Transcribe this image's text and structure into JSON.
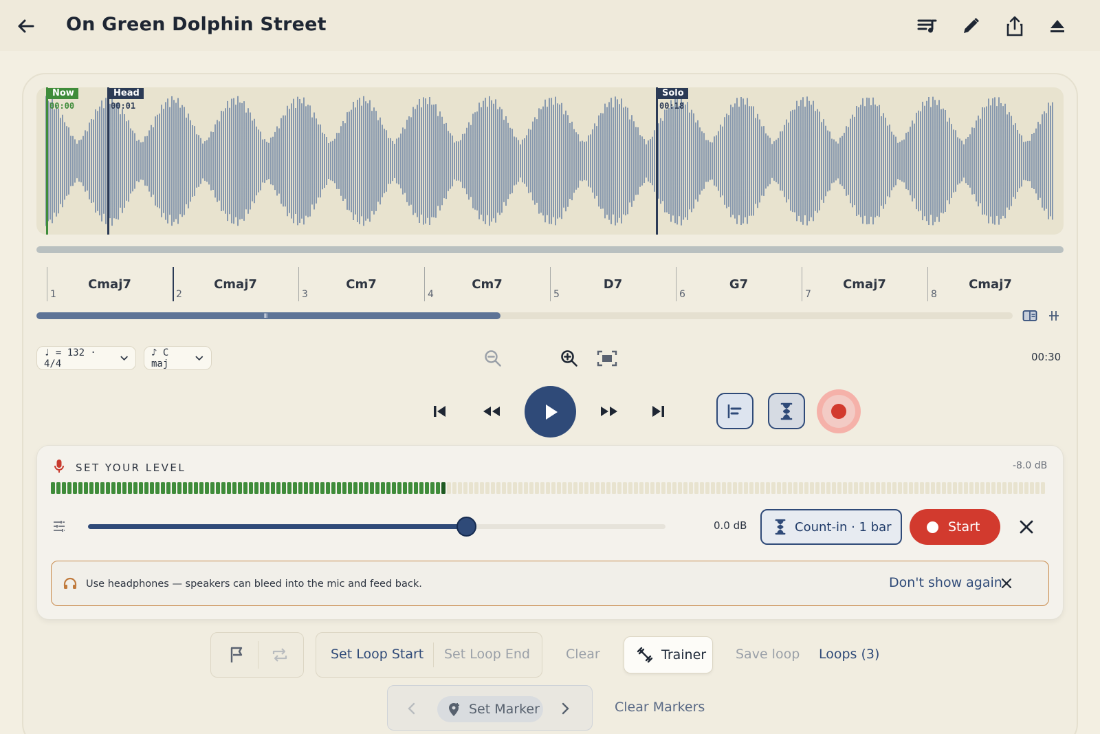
{
  "app": {
    "title": "On Green Dolphin Street",
    "icons": [
      "back-arrow-icon",
      "playlist-icon",
      "edit-pencil-icon",
      "share-icon",
      "eject-icon"
    ]
  },
  "waveform": {
    "markers": [
      {
        "label": "Now",
        "time": "00:00",
        "color": "#3f8c3a"
      },
      {
        "label": "Head",
        "time": "00:01",
        "color": "#2b3a55"
      },
      {
        "label": "Solo",
        "time": "00:18",
        "color": "#2b3a55"
      }
    ],
    "color": "#6f86a6"
  },
  "bars": [
    {
      "num": "1",
      "chord": "Cmaj7"
    },
    {
      "num": "2",
      "chord": "Cmaj7"
    },
    {
      "num": "3",
      "chord": "Cm7"
    },
    {
      "num": "4",
      "chord": "Cm7"
    },
    {
      "num": "5",
      "chord": "D7"
    },
    {
      "num": "6",
      "chord": "G7"
    },
    {
      "num": "7",
      "chord": "Cmaj7"
    },
    {
      "num": "8",
      "chord": "Cmaj7"
    }
  ],
  "scrub": {
    "progress": 0.475,
    "grip": "III"
  },
  "controls": {
    "tempo_chip": "♩ = 132 · 4/4",
    "key_chip": "♪ C maj",
    "duration": "00:30"
  },
  "level": {
    "title": "SET YOUR LEVEL",
    "db_reading": "-8.0 dB",
    "meter_fraction": 0.395,
    "gain_value": "0.0 dB",
    "gain_fraction": 0.655,
    "countin_label": "Count-in · 1 bar",
    "start_label": "Start",
    "tip_text": "Use headphones — speakers can bleed into the mic and feed back.",
    "dont_show": "Don't show again"
  },
  "loop": {
    "set_start": "Set Loop Start",
    "set_end": "Set Loop End",
    "clear": "Clear",
    "trainer": "Trainer",
    "save": "Save loop",
    "loops": "Loops (3)"
  },
  "markers_bar": {
    "set_marker": "Set Marker",
    "clear_markers": "Clear Markers"
  },
  "colors": {
    "accent": "#2f4a78",
    "record": "#d23a2e",
    "meter_on": "#3f8c3a",
    "background": "#f3efe2"
  }
}
